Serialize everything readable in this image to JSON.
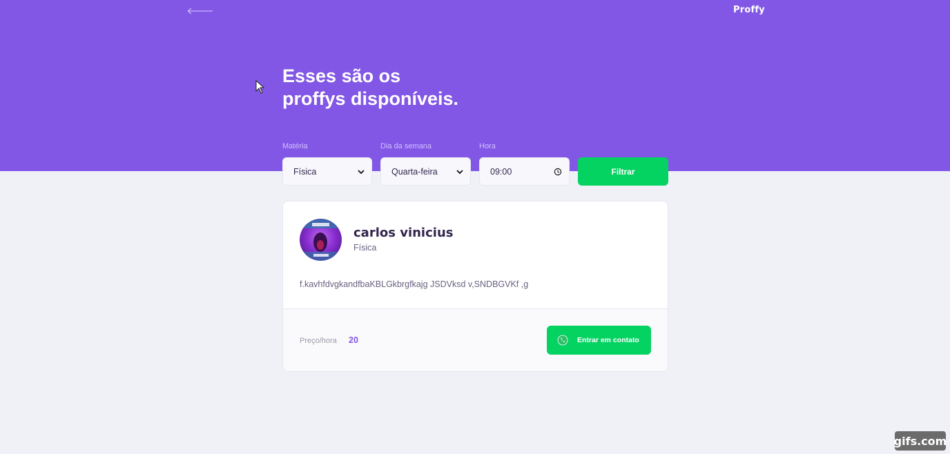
{
  "header": {
    "brand": "Proffy",
    "title_line1": "Esses são os",
    "title_line2": "proffys disponíveis.",
    "back_icon": "arrow-left-icon"
  },
  "filters": {
    "subject_label": "Matéria",
    "subject_value": "Física",
    "weekday_label": "Dia da semana",
    "weekday_value": "Quarta-feira",
    "time_label": "Hora",
    "time_value": "09:00",
    "submit_label": "Filtrar"
  },
  "teacher": {
    "name": "carlos vinicius",
    "subject": "Física",
    "bio": "f.kavhfdvgkandfbaKBLGkbrgfkajg JSDVksd v,SNDBGVKf ,g",
    "price_label": "Preço/hora",
    "price_value": "20",
    "contact_label": "Entrar em contato"
  },
  "watermark": "gifs.com",
  "colors": {
    "primary": "#8257e5",
    "secondary": "#04d361",
    "background": "#f0f0f7",
    "text_title": "#32264d",
    "text_base": "#6a6180"
  }
}
